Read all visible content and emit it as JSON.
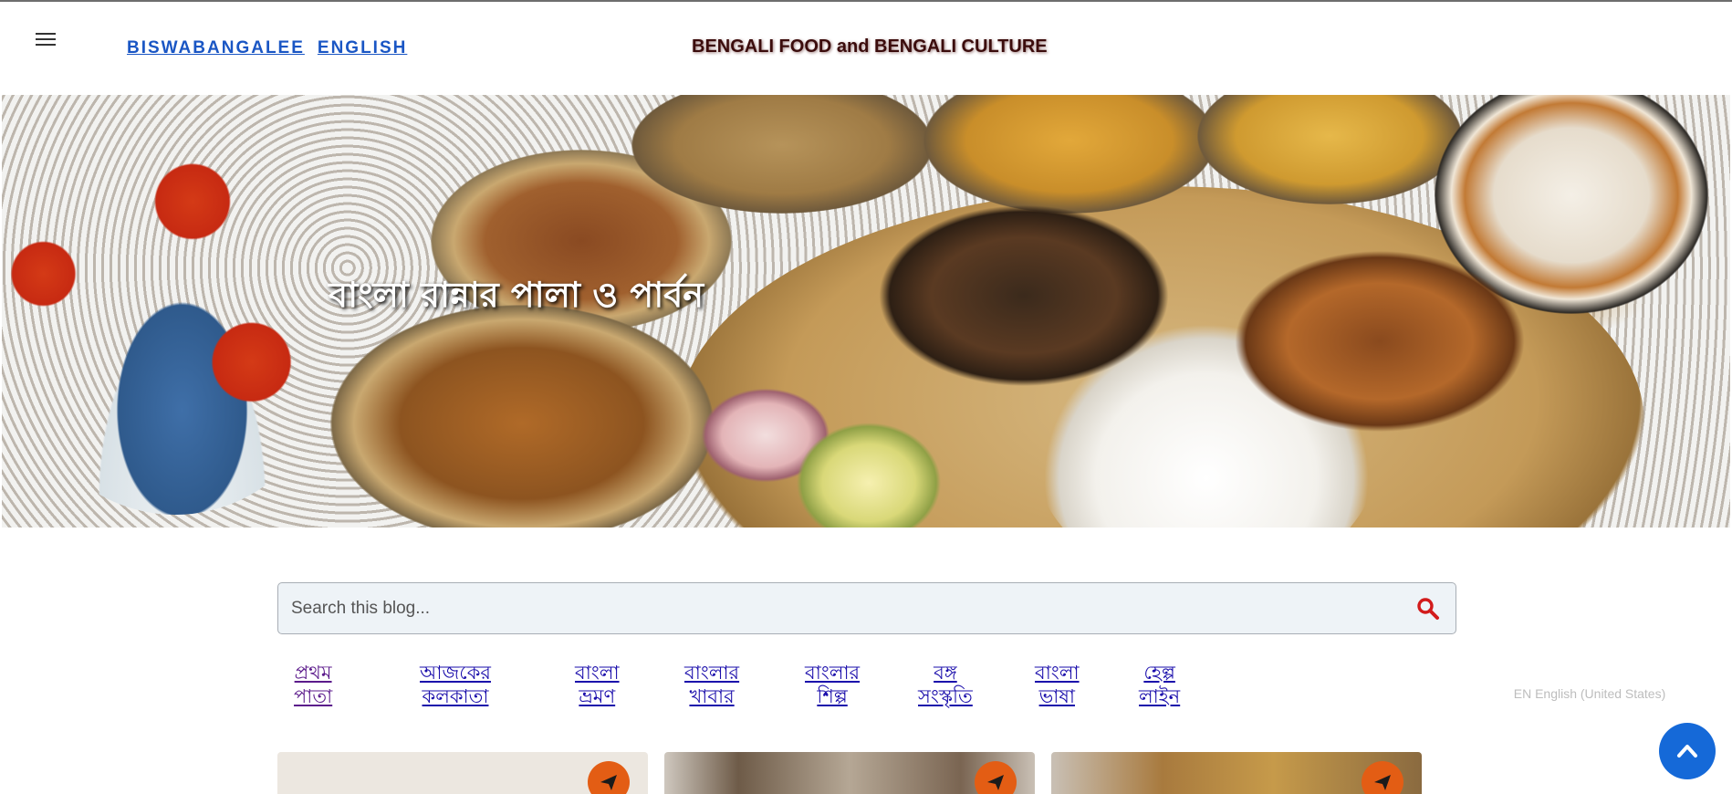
{
  "header": {
    "brand_links": [
      "BISWABANGALEE",
      "ENGLISH"
    ],
    "site_title": "BENGALI FOOD and BENGALI CULTURE"
  },
  "hero": {
    "headline": "বাংলা রান্নার পালা ও পার্বন"
  },
  "search": {
    "placeholder": "Search this blog..."
  },
  "nav": {
    "items": [
      {
        "line1": "প্রথম",
        "line2": "পাতা"
      },
      {
        "line1": "আজকের",
        "line2": "কলকাতা"
      },
      {
        "line1": "বাংলা",
        "line2": "ভ্রমণ"
      },
      {
        "line1": "বাংলার",
        "line2": "খাবার"
      },
      {
        "line1": "বাংলার",
        "line2": "শিল্প"
      },
      {
        "line1": "বঙ্গ",
        "line2": "সংস্কৃতি"
      },
      {
        "line1": "বাংলা",
        "line2": "ভাষা"
      },
      {
        "line1": "হেল্প",
        "line2": "লাইন"
      }
    ]
  },
  "language_widget": {
    "label": "EN English (United States)"
  },
  "colors": {
    "link": "#1a0dab",
    "visited_link": "#5b1a8b",
    "brand_link": "#1a56c4",
    "fab": "#1569d8",
    "share_badge": "#e35d14",
    "search_icon": "#d21b1b"
  },
  "icons": [
    "menu-icon",
    "search-icon",
    "chevron-up-icon",
    "share-icon"
  ]
}
